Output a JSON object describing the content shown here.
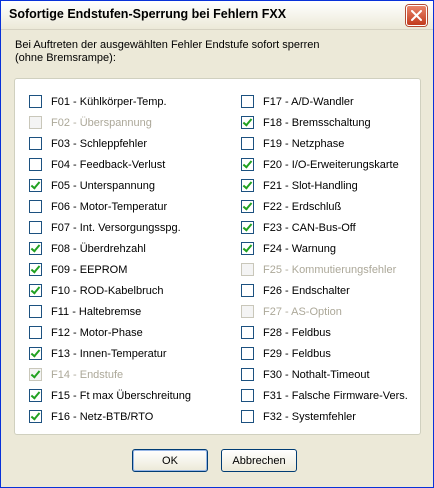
{
  "window": {
    "title": "Sofortige Endstufen-Sperrung bei Fehlern FXX"
  },
  "description": {
    "line1": "Bei Auftreten der ausgewählten Fehler Endstufe sofort sperren",
    "line2": "(ohne Bremsrampe):"
  },
  "errors_left": [
    {
      "label": "F01 - Kühlkörper-Temp.",
      "checked": false,
      "enabled": true
    },
    {
      "label": "F02 - Überspannung",
      "checked": false,
      "enabled": false
    },
    {
      "label": "F03 - Schleppfehler",
      "checked": false,
      "enabled": true
    },
    {
      "label": "F04 - Feedback-Verlust",
      "checked": false,
      "enabled": true
    },
    {
      "label": "F05 - Unterspannung",
      "checked": true,
      "enabled": true
    },
    {
      "label": "F06 - Motor-Temperatur",
      "checked": false,
      "enabled": true
    },
    {
      "label": "F07 - Int. Versorgungsspg.",
      "checked": false,
      "enabled": true
    },
    {
      "label": "F08 - Überdrehzahl",
      "checked": true,
      "enabled": true
    },
    {
      "label": "F09 - EEPROM",
      "checked": true,
      "enabled": true
    },
    {
      "label": "F10 - ROD-Kabelbruch",
      "checked": true,
      "enabled": true
    },
    {
      "label": "F11 - Haltebremse",
      "checked": false,
      "enabled": true
    },
    {
      "label": "F12 - Motor-Phase",
      "checked": false,
      "enabled": true
    },
    {
      "label": "F13 - Innen-Temperatur",
      "checked": true,
      "enabled": true
    },
    {
      "label": "F14 - Endstufe",
      "checked": true,
      "enabled": false
    },
    {
      "label": "F15 - Ft max Überschreitung",
      "checked": true,
      "enabled": true
    },
    {
      "label": "F16 - Netz-BTB/RTO",
      "checked": true,
      "enabled": true
    }
  ],
  "errors_right": [
    {
      "label": "F17 - A/D-Wandler",
      "checked": false,
      "enabled": true
    },
    {
      "label": "F18 - Bremsschaltung",
      "checked": true,
      "enabled": true
    },
    {
      "label": "F19 - Netzphase",
      "checked": false,
      "enabled": true
    },
    {
      "label": "F20 - I/O-Erweiterungskarte",
      "checked": true,
      "enabled": true
    },
    {
      "label": "F21 - Slot-Handling",
      "checked": true,
      "enabled": true
    },
    {
      "label": "F22 - Erdschluß",
      "checked": true,
      "enabled": true
    },
    {
      "label": "F23 - CAN-Bus-Off",
      "checked": true,
      "enabled": true
    },
    {
      "label": "F24 - Warnung",
      "checked": true,
      "enabled": true
    },
    {
      "label": "F25 - Kommutierungsfehler",
      "checked": false,
      "enabled": false
    },
    {
      "label": "F26 - Endschalter",
      "checked": false,
      "enabled": true
    },
    {
      "label": "F27 - AS-Option",
      "checked": false,
      "enabled": false
    },
    {
      "label": "F28 - Feldbus",
      "checked": false,
      "enabled": true
    },
    {
      "label": "F29 - Feldbus",
      "checked": false,
      "enabled": true
    },
    {
      "label": "F30 - Nothalt-Timeout",
      "checked": false,
      "enabled": true
    },
    {
      "label": "F31 - Falsche Firmware-Vers.",
      "checked": false,
      "enabled": true
    },
    {
      "label": "F32 - Systemfehler",
      "checked": false,
      "enabled": true
    }
  ],
  "buttons": {
    "ok": "OK",
    "cancel": "Abbrechen"
  },
  "icons": {
    "close": "close-icon"
  },
  "colors": {
    "title_border": "#0831d9",
    "check": "#21a121",
    "close_button": "#c23a1d"
  }
}
